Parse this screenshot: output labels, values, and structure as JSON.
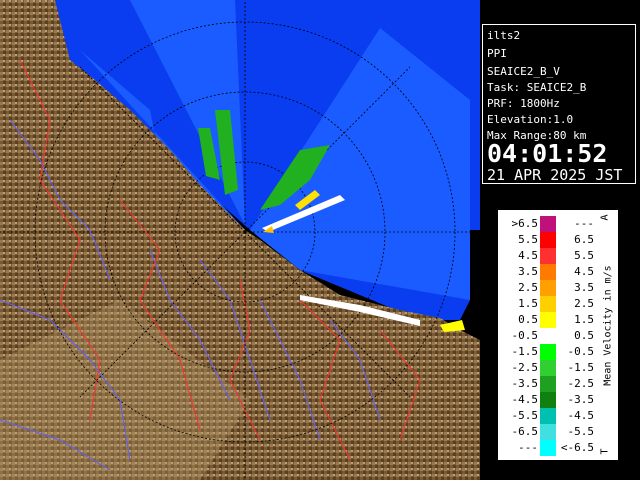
{
  "info": {
    "site": "ilts2",
    "mode": "PPI",
    "product": "SEAICE2_B_V",
    "task": "Task: SEAICE2_B",
    "prf": "PRF: 1800Hz",
    "elevation": "Elevation:1.0",
    "max_range": "Max Range:80 km",
    "time": "04:01:52",
    "date": "21 APR 2025 JST"
  },
  "legend": {
    "title": "Mean Velocity in m/s",
    "top_mark": "A",
    "bottom_mark": "T",
    "rows": [
      {
        "lo": ">6.5",
        "hi": "---",
        "color": "#c0107a"
      },
      {
        "lo": "5.5",
        "hi": "6.5",
        "color": "#ff0000"
      },
      {
        "lo": "4.5",
        "hi": "5.5",
        "color": "#ff3030"
      },
      {
        "lo": "3.5",
        "hi": "4.5",
        "color": "#ff7a00"
      },
      {
        "lo": "2.5",
        "hi": "3.5",
        "color": "#ffa000"
      },
      {
        "lo": "1.5",
        "hi": "2.5",
        "color": "#ffd000"
      },
      {
        "lo": "0.5",
        "hi": "1.5",
        "color": "#ffff00"
      },
      {
        "lo": "-0.5",
        "hi": "0.5",
        "color": "#ffffff"
      },
      {
        "lo": "-1.5",
        "hi": "-0.5",
        "color": "#00ff00"
      },
      {
        "lo": "-2.5",
        "hi": "-1.5",
        "color": "#30d030"
      },
      {
        "lo": "-3.5",
        "hi": "-2.5",
        "color": "#20a020"
      },
      {
        "lo": "-4.5",
        "hi": "-3.5",
        "color": "#108010"
      },
      {
        "lo": "-5.5",
        "hi": "-4.5",
        "color": "#00c0b0"
      },
      {
        "lo": "-6.5",
        "hi": "-5.5",
        "color": "#40e0e0"
      },
      {
        "lo": "---",
        "hi": "<-6.5",
        "color": "#00ffff"
      }
    ]
  },
  "map_colors": {
    "sea_range": "#0a3cf0",
    "echo_area": "#1a5cff",
    "land": "#8a6a40",
    "rivers": "#6060ff",
    "boundaries": "#ff3030"
  }
}
